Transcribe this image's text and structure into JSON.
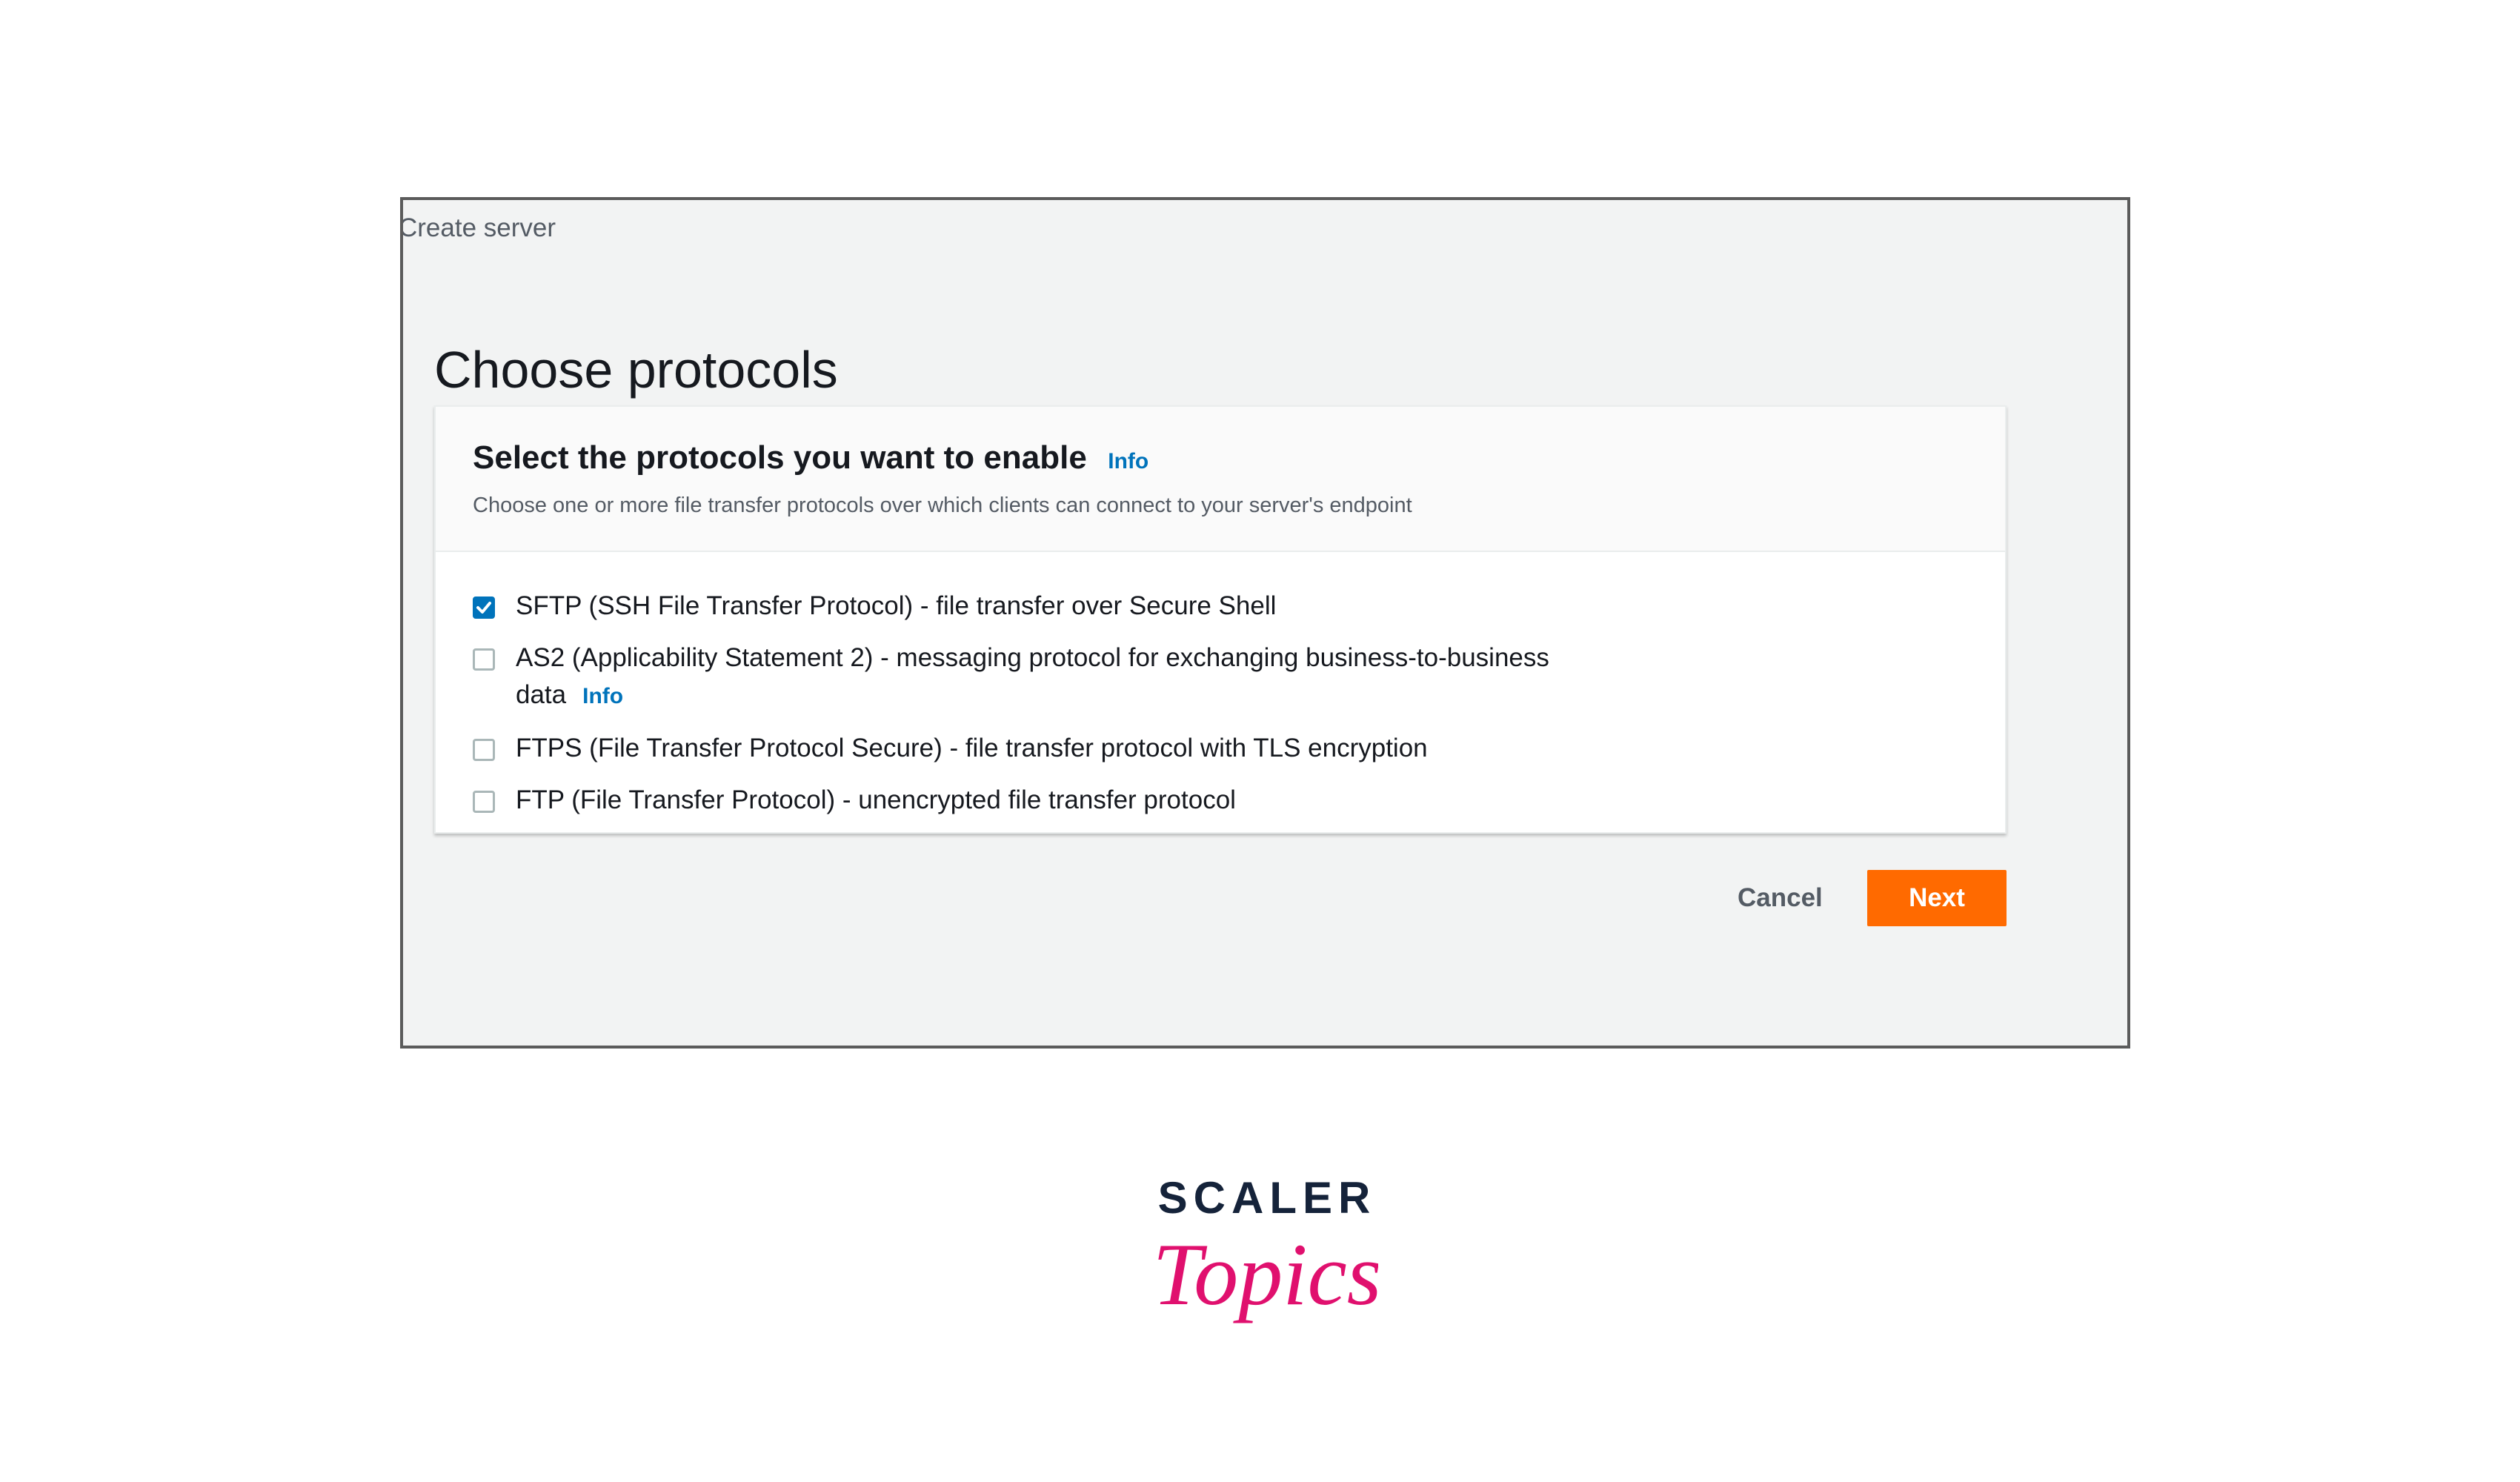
{
  "breadcrumb": "Create server",
  "page_title": "Choose protocols",
  "panel": {
    "title": "Select the protocols you want to enable",
    "info_label": "Info",
    "description": "Choose one or more file transfer protocols over which clients can connect to your server's endpoint"
  },
  "protocols": [
    {
      "label": "SFTP (SSH File Transfer Protocol) - file transfer over Secure Shell",
      "checked": true,
      "info": ""
    },
    {
      "label": "AS2 (Applicability Statement 2) - messaging protocol for exchanging business-to-business data",
      "checked": false,
      "info": "Info"
    },
    {
      "label": "FTPS (File Transfer Protocol Secure) - file transfer protocol with TLS encryption",
      "checked": false,
      "info": ""
    },
    {
      "label": "FTP (File Transfer Protocol) - unencrypted file transfer protocol",
      "checked": false,
      "info": ""
    }
  ],
  "actions": {
    "cancel_label": "Cancel",
    "next_label": "Next"
  },
  "logo": {
    "line1": "SCALER",
    "line2": "Topics"
  },
  "colors": {
    "accent_orange": "#ff6a00",
    "link_blue": "#0073bb",
    "logo_navy": "#15233a",
    "logo_pink": "#e0106e"
  },
  "icons": {
    "checkbox_checked": "checkmark-icon"
  }
}
